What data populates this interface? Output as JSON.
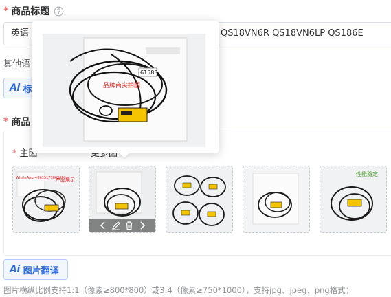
{
  "title_field": {
    "required_mark": "*",
    "label": "商品标题",
    "help_icon": "question-circle-icon",
    "value": "英语版 QS18VN6R QS18VN6LP QS186E",
    "value_visible_left": "英语",
    "value_visible_right": "P QS18VN6R QS18VN6LP QS186E"
  },
  "other_title": {
    "label": "其他语"
  },
  "ai_title_button": {
    "glyph": "Ai",
    "label": "标"
  },
  "images_field": {
    "required_mark": "*",
    "label": "商品"
  },
  "main_image": {
    "required_mark": "*",
    "label": "主图"
  },
  "more_images": {
    "label": "更多图"
  },
  "thumbnails": [
    {
      "name": "thumb-1",
      "stamp": "WhatsApp:+8615173663653",
      "note": "产品展示"
    },
    {
      "name": "thumb-2",
      "hovered": true
    },
    {
      "name": "thumb-3"
    },
    {
      "name": "thumb-4"
    },
    {
      "name": "thumb-5",
      "tag": "性能稳定"
    }
  ],
  "thumb_toolbar": {
    "prev_icon": "chevron-left-icon",
    "edit_icon": "pencil-icon",
    "delete_icon": "trash-icon",
    "next_icon": "chevron-right-icon"
  },
  "preview_popover": {
    "sensor_code": "61583",
    "watermark": "品牌商实拍图"
  },
  "ai_translate_button": {
    "glyph": "Ai",
    "label": "图片翻译"
  },
  "hint": "图片横纵比例支持1:1（像素≥800*800）或3:4（像素≥750*1000），支持jpg、jpeg、png格式；",
  "colors": {
    "accent": "#2f6bd8",
    "required": "#f56c6c",
    "sensor_yellow": "#f5c400"
  }
}
